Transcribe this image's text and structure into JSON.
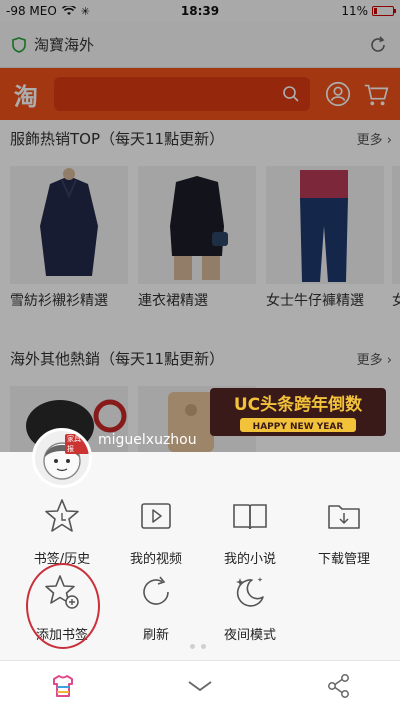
{
  "status_bar": {
    "carrier": "-98 MEO",
    "time": "18:39",
    "battery": "11%"
  },
  "address_bar": {
    "title": "淘寶海外"
  },
  "header": {
    "logo": "淘"
  },
  "section1": {
    "title": "服飾热销TOP（每天11點更新）",
    "more": "更多",
    "products": [
      {
        "label": "雪紡衫襯衫精選"
      },
      {
        "label": "連衣裙精選"
      },
      {
        "label": "女士牛仔褲精選"
      },
      {
        "label": "女"
      }
    ]
  },
  "section2": {
    "title": "海外其他熱銷（每天11點更新）",
    "more": "更多"
  },
  "promo": {
    "line1": "UC头条跨年倒数",
    "line2": "HAPPY NEW YEAR"
  },
  "user": {
    "username": "miguelxuzhou",
    "avatar_badge": "家具报"
  },
  "menu": {
    "row1": [
      {
        "label": "书签/历史",
        "icon": "star-icon"
      },
      {
        "label": "我的视频",
        "icon": "video-icon"
      },
      {
        "label": "我的小说",
        "icon": "book-icon"
      },
      {
        "label": "下载管理",
        "icon": "download-folder-icon"
      }
    ],
    "row2": [
      {
        "label": "添加书签",
        "icon": "add-bookmark-icon"
      },
      {
        "label": "刷新",
        "icon": "refresh-icon"
      },
      {
        "label": "夜间模式",
        "icon": "night-mode-icon"
      }
    ]
  },
  "toolbar": {
    "icons": [
      "theme-icon",
      "collapse-chevron-icon",
      "share-icon"
    ]
  },
  "colors": {
    "taobao_orange": "#f0521a",
    "highlight_red": "#c9303a"
  }
}
